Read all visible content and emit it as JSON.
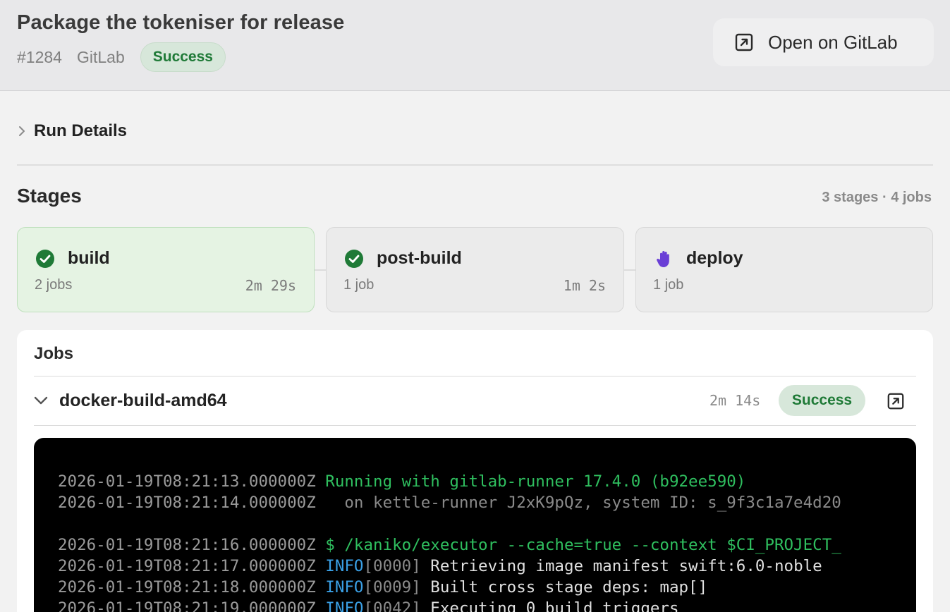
{
  "header": {
    "title": "Package the tokeniser for release",
    "run_number": "#1284",
    "provider": "GitLab",
    "status": "Success",
    "open_button_label": "Open on GitLab"
  },
  "run_details": {
    "label": "Run Details"
  },
  "stages": {
    "title": "Stages",
    "summary": "3 stages · 4 jobs",
    "items": [
      {
        "name": "build",
        "jobs": "2 jobs",
        "duration": "2m 29s",
        "status_icon": "check-circle-icon"
      },
      {
        "name": "post-build",
        "jobs": "1 job",
        "duration": "1m 2s",
        "status_icon": "check-circle-icon"
      },
      {
        "name": "deploy",
        "jobs": "1 job",
        "duration": "",
        "status_icon": "hand-icon"
      }
    ]
  },
  "jobs": {
    "title": "Jobs",
    "current": {
      "name": "docker-build-amd64",
      "duration": "2m 14s",
      "status": "Success"
    },
    "log": [
      {
        "ts": "2026-01-19T08:21:13.000000Z",
        "parts": [
          {
            "kind": "green",
            "text": "Running with gitlab-runner 17.4.0 (b92ee590)"
          }
        ]
      },
      {
        "ts": "2026-01-19T08:21:14.000000Z",
        "parts": [
          {
            "kind": "dim",
            "text": "  on kettle-runner J2xK9pQz, system ID: s_9f3c1a7e4d20"
          }
        ]
      },
      {
        "ts": "",
        "parts": []
      },
      {
        "ts": "2026-01-19T08:21:16.000000Z",
        "parts": [
          {
            "kind": "green",
            "text": "$ /kaniko/executor --cache=true --context $CI_PROJECT_"
          }
        ]
      },
      {
        "ts": "2026-01-19T08:21:17.000000Z",
        "parts": [
          {
            "kind": "info",
            "text": "INFO"
          },
          {
            "kind": "dim",
            "text": "[0000]"
          },
          {
            "kind": "txt",
            "text": " Retrieving image manifest swift:6.0-noble"
          }
        ]
      },
      {
        "ts": "2026-01-19T08:21:18.000000Z",
        "parts": [
          {
            "kind": "info",
            "text": "INFO"
          },
          {
            "kind": "dim",
            "text": "[0009]"
          },
          {
            "kind": "txt",
            "text": " Built cross stage deps: map[]"
          }
        ]
      },
      {
        "ts": "2026-01-19T08:21:19.000000Z",
        "parts": [
          {
            "kind": "info",
            "text": "INFO"
          },
          {
            "kind": "dim",
            "text": "[0042]"
          },
          {
            "kind": "txt",
            "text": " Executing 0 build triggers"
          }
        ]
      }
    ]
  },
  "colors": {
    "success": "#1f7a37",
    "success_bg": "#d7e7da",
    "manual": "#6a3fd6",
    "terminal_green": "#2fbf5f",
    "terminal_info": "#3aa0e6"
  }
}
